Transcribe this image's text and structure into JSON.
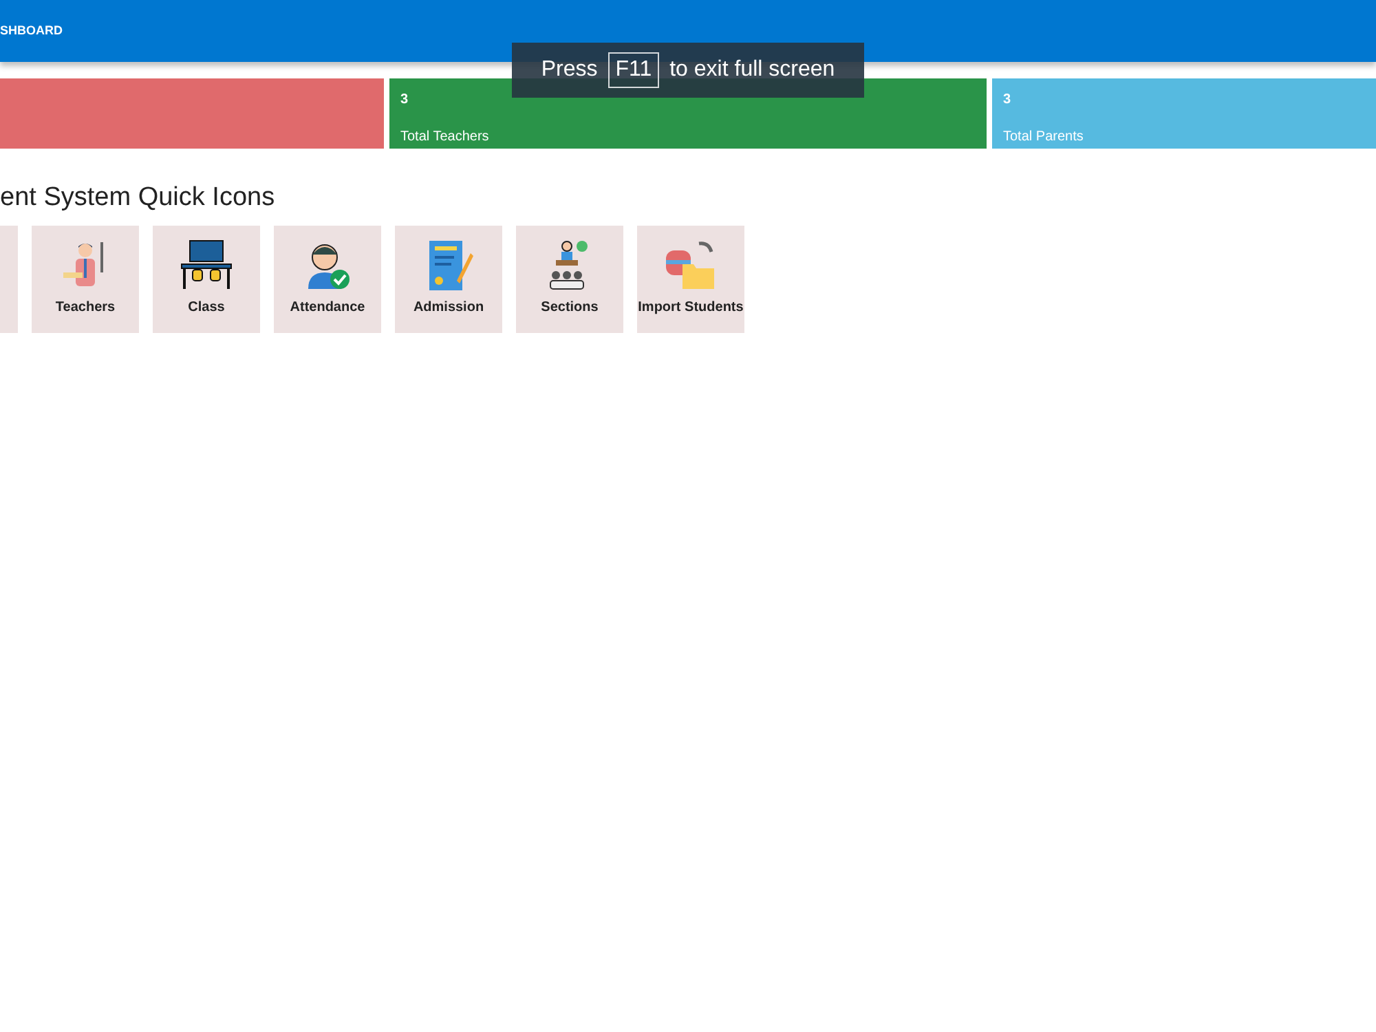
{
  "header": {
    "title": "SHBOARD"
  },
  "stat_cards": [
    {
      "color": "#e06a6c"
    },
    {
      "count": "3",
      "label": "Total Teachers",
      "color": "#2a9449"
    },
    {
      "count": "3",
      "label": "Total Parents",
      "color": "#56bae0"
    }
  ],
  "section_title": "ent System Quick Icons",
  "quick_icons": [
    {
      "kind": "clipped"
    },
    {
      "label": "Teachers"
    },
    {
      "label": "Class"
    },
    {
      "label": "Attendance"
    },
    {
      "label": "Admission"
    },
    {
      "label": "Sections"
    },
    {
      "label": "Import Students"
    }
  ],
  "fullscreen_notice": {
    "before": "Press",
    "key": "F11",
    "after": "to exit full screen"
  }
}
